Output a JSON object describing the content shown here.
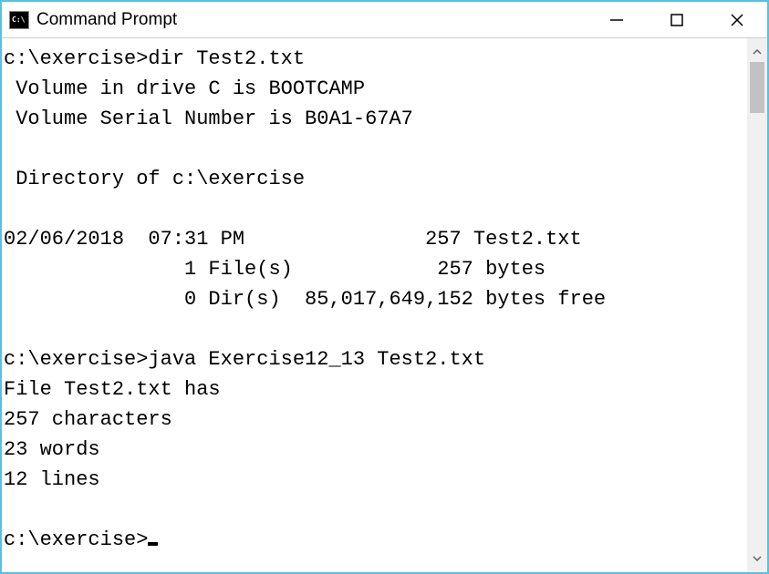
{
  "window": {
    "title": "Command Prompt"
  },
  "terminal": {
    "lines": {
      "l01": "c:\\exercise>dir Test2.txt",
      "l02": " Volume in drive C is BOOTCAMP",
      "l03": " Volume Serial Number is B0A1-67A7",
      "l04": "",
      "l05": " Directory of c:\\exercise",
      "l06": "",
      "l07": "02/06/2018  07:31 PM               257 Test2.txt",
      "l08": "               1 File(s)            257 bytes",
      "l09": "               0 Dir(s)  85,017,649,152 bytes free",
      "l10": "",
      "l11": "c:\\exercise>java Exercise12_13 Test2.txt",
      "l12": "File Test2.txt has",
      "l13": "257 characters",
      "l14": "23 words",
      "l15": "12 lines",
      "l16": "",
      "l17": "c:\\exercise>"
    }
  }
}
